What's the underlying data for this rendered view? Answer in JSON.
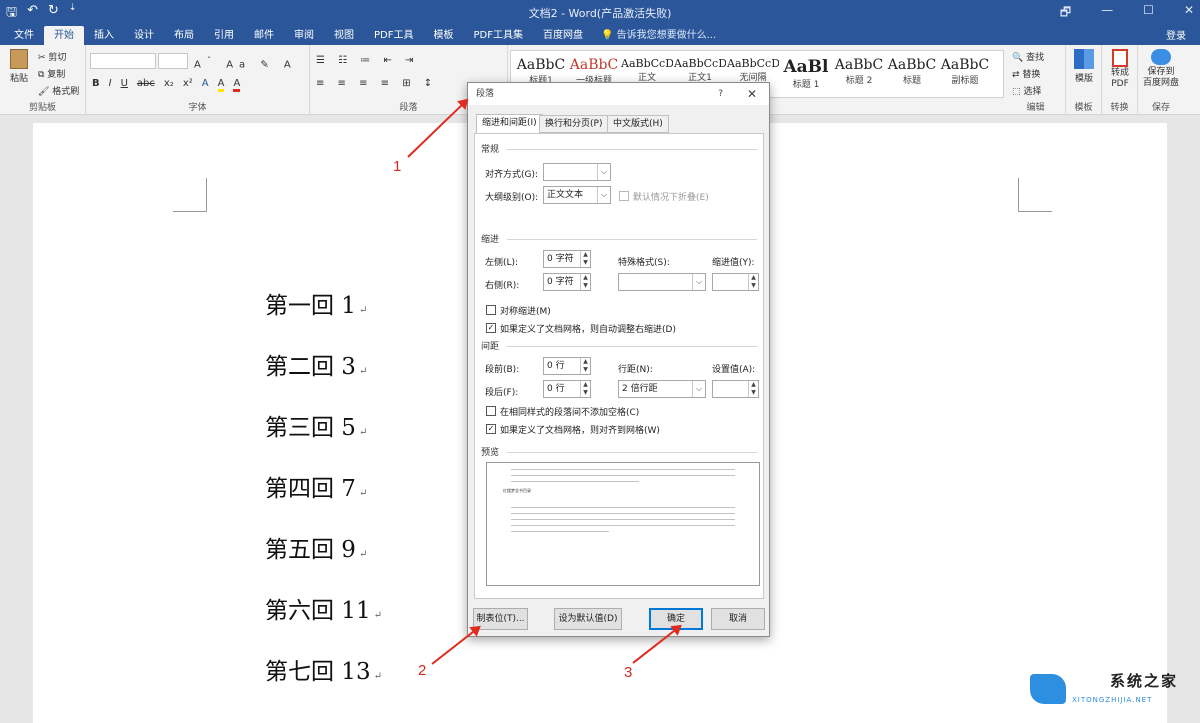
{
  "qat": {
    "save": "🖫",
    "undo": "↶",
    "redo": "↻",
    "customize": "⇣"
  },
  "window_title": "文档2 - Word(产品激活失败)",
  "window_controls": [
    "🗗",
    "—",
    "☐",
    "✕"
  ],
  "tabs": [
    "文件",
    "开始",
    "插入",
    "设计",
    "布局",
    "引用",
    "邮件",
    "审阅",
    "视图",
    "PDF工具",
    "模板",
    "PDF工具集",
    "百度网盘"
  ],
  "tell_me": "告诉我您想要做什么...",
  "login": "登录",
  "ribbon": {
    "clipboard": {
      "paste": "粘贴",
      "cut": "剪切",
      "copy": "复制",
      "format_painter": "格式刷",
      "label": "剪贴板"
    },
    "font": {
      "label": "字体",
      "buttons": [
        "B",
        "I",
        "U",
        "abc",
        "x₂",
        "x²",
        "A",
        "A",
        "A"
      ],
      "size_grow": "A",
      "aa": "Aa"
    },
    "paragraph": {
      "label": "段落"
    },
    "styles": [
      {
        "sample": "AaBbC",
        "name": "标题1"
      },
      {
        "sample": "AaBbC",
        "name": "一级标题"
      },
      {
        "sample": "AaBbCcD",
        "name": "正文"
      },
      {
        "sample": "AaBbCcD",
        "name": "正文1"
      },
      {
        "sample": "AaBbCcD",
        "name": "无间隔"
      },
      {
        "sample": "AaBl",
        "name": "标题 1"
      },
      {
        "sample": "AaBbC",
        "name": "标题 2"
      },
      {
        "sample": "AaBbC",
        "name": "标题"
      },
      {
        "sample": "AaBbC",
        "name": "副标题"
      }
    ],
    "editing": {
      "find": "查找",
      "replace": "替换",
      "select": "选择",
      "label": "编辑"
    },
    "template": {
      "button": "模版",
      "label": "模板"
    },
    "convert": {
      "button_line1": "转成",
      "button_line2": "PDF",
      "label": "转换"
    },
    "save": {
      "button_line1": "保存到",
      "button_line2": "百度网盘",
      "label": "保存"
    }
  },
  "document_lines": [
    "第一回 1",
    "第二回 3",
    "第三回 5",
    "第四回 7",
    "第五回 9",
    "第六回 11",
    "第七回 13"
  ],
  "paragraph_mark": "↵",
  "dialog": {
    "title": "段落",
    "help": "?",
    "close": "✕",
    "tabs": [
      "缩进和间距(I)",
      "换行和分页(P)",
      "中文版式(H)"
    ],
    "general": {
      "section": "常规",
      "alignment_label": "对齐方式(G):",
      "alignment_value": "",
      "outline_label": "大纲级别(O):",
      "outline_value": "正文文本",
      "collapse_label": "默认情况下折叠(E)"
    },
    "indent": {
      "section": "缩进",
      "left_label": "左侧(L):",
      "left_value": "0 字符",
      "right_label": "右侧(R):",
      "right_value": "0 字符",
      "special_label": "特殊格式(S):",
      "special_value": "",
      "by_label": "缩进值(Y):",
      "by_value": "",
      "mirror_label": "对称缩进(M)",
      "auto_adjust_label": "如果定义了文档网格，则自动调整右缩进(D)"
    },
    "spacing": {
      "section": "间距",
      "before_label": "段前(B):",
      "before_value": "0 行",
      "after_label": "段后(F):",
      "after_value": "0 行",
      "line_label": "行距(N):",
      "line_value": "2 倍行距",
      "at_label": "设置值(A):",
      "at_value": "",
      "no_space_label": "在相同样式的段落间不添加空格(C)",
      "snap_grid_label": "如果定义了文档网格，则对齐到网格(W)"
    },
    "preview": {
      "section": "预览",
      "sample_text": "红楼梦全书目录"
    },
    "buttons": {
      "tabs": "制表位(T)...",
      "set_default": "设为默认值(D)",
      "ok": "确定",
      "cancel": "取消"
    }
  },
  "annotations": [
    "1",
    "2",
    "3"
  ],
  "watermark": {
    "site_cn": "系统之家",
    "site_en": "XITONGZHIJIA.NET",
    "accent": "#2d8fe0"
  },
  "colors": {
    "title_bar": "#2b579a",
    "arrow": "#e02b20"
  }
}
